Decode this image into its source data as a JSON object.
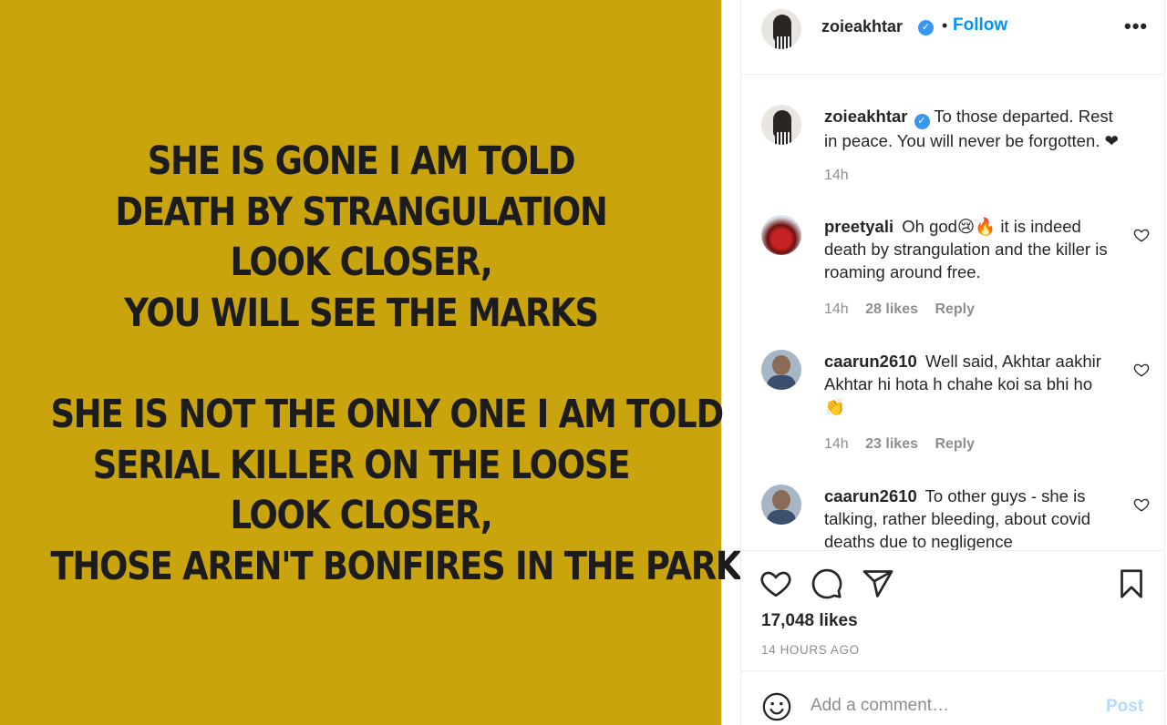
{
  "post": {
    "stanza1": [
      "SHE IS GONE I AM TOLD",
      "DEATH BY STRANGULATION",
      "LOOK CLOSER,",
      "YOU WILL SEE THE MARKS"
    ],
    "stanza2": [
      "SHE IS NOT THE ONLY ONE I AM TOLD",
      "SERIAL KILLER ON THE LOOSE",
      "LOOK CLOSER,",
      "THOSE AREN'T BONFIRES IN THE PARKS"
    ],
    "background_color": "#c9a40c"
  },
  "header": {
    "username": "zoieakhtar",
    "verified_icon": "verified-badge-icon",
    "separator": "•",
    "follow_label": "Follow",
    "more_icon": "more-options-icon",
    "more_glyph": "•••"
  },
  "caption": {
    "username": "zoieakhtar",
    "text": "To those departed. Rest in peace. You will never be forgotten. ❤",
    "time": "14h"
  },
  "comments": [
    {
      "username": "preetyali",
      "text": "Oh god😢🔥 it is indeed death by strangulation and the killer is roaming around free.",
      "time": "14h",
      "likes": "28 likes",
      "reply": "Reply"
    },
    {
      "username": "caarun2610",
      "text": "Well said, Akhtar aakhir Akhtar hi hota h chahe koi sa bhi ho👏",
      "time": "14h",
      "likes": "23 likes",
      "reply": "Reply"
    },
    {
      "username": "caarun2610",
      "text": "To other guys - she is talking, rather bleeding, about covid deaths due to negligence"
    }
  ],
  "actions": {
    "likes": "17,048 likes",
    "time": "14 HOURS AGO"
  },
  "add_comment": {
    "placeholder": "Add a comment…",
    "post_label": "Post"
  },
  "colors": {
    "accent": "#0095f6",
    "post_disabled": "#b3dbff",
    "muted": "#8e8e8e"
  }
}
